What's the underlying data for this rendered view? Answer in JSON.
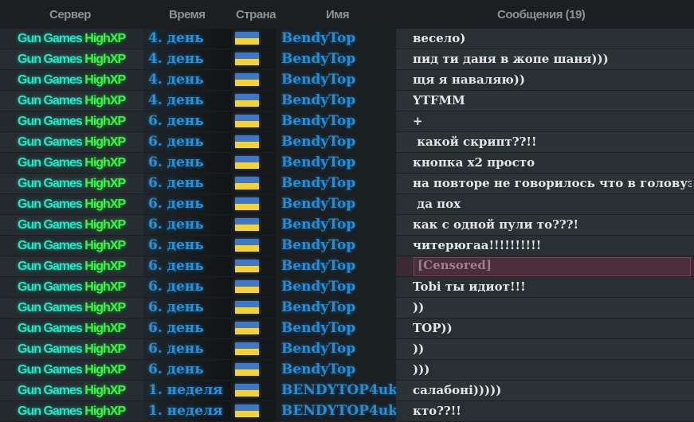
{
  "header": {
    "server": "Сервер",
    "time": "Время",
    "country": "Страна",
    "name": "Имя",
    "messages": "Сообщения (19)"
  },
  "colors": {
    "server_part1": "#24e6c4",
    "server_part2": "#3cf34a",
    "time": "#2e8fd0",
    "name": "#2a8bd0",
    "message": "#e6e6e6",
    "flag_blue": "#3f78c6",
    "flag_yellow": "#f3d23b",
    "censored_bg": "#4a2f3a"
  },
  "rows": [
    {
      "server1": "Gun Games",
      "server2": "HighXP",
      "time": "4. день",
      "flag": "ukraine-flag-icon",
      "name": "BendyTop",
      "message": "весело)"
    },
    {
      "server1": "Gun Games",
      "server2": "HighXP",
      "time": "4. день",
      "flag": "ukraine-flag-icon",
      "name": "BendyTop",
      "message": "пид ти даня в жопе шаня)))"
    },
    {
      "server1": "Gun Games",
      "server2": "HighXP",
      "time": "4. день",
      "flag": "ukraine-flag-icon",
      "name": "BendyTop",
      "message": "щя я наваляю))"
    },
    {
      "server1": "Gun Games",
      "server2": "HighXP",
      "time": "4. день",
      "flag": "ukraine-flag-icon",
      "name": "BendyTop",
      "message": "YTFMM"
    },
    {
      "server1": "Gun Games",
      "server2": "HighXP",
      "time": "6. день",
      "flag": "ukraine-flag-icon",
      "name": "BendyTop",
      "message": "+"
    },
    {
      "server1": "Gun Games",
      "server2": "HighXP",
      "time": "6. день",
      "flag": "ukraine-flag-icon",
      "name": "BendyTop",
      "message": " какой скрипт??!!"
    },
    {
      "server1": "Gun Games",
      "server2": "HighXP",
      "time": "6. день",
      "flag": "ukraine-flag-icon",
      "name": "BendyTop",
      "message": "кнопка x2 просто"
    },
    {
      "server1": "Gun Games",
      "server2": "HighXP",
      "time": "6. день",
      "flag": "ukraine-flag-icon",
      "name": "BendyTop",
      "message": "на повторе не говорилось что в головуэ"
    },
    {
      "server1": "Gun Games",
      "server2": "HighXP",
      "time": "6. день",
      "flag": "ukraine-flag-icon",
      "name": "BendyTop",
      "message": " да пох"
    },
    {
      "server1": "Gun Games",
      "server2": "HighXP",
      "time": "6. день",
      "flag": "ukraine-flag-icon",
      "name": "BendyTop",
      "message": "как с одной пули то???!"
    },
    {
      "server1": "Gun Games",
      "server2": "HighXP",
      "time": "6. день",
      "flag": "ukraine-flag-icon",
      "name": "BendyTop",
      "message": "читерюгаа!!!!!!!!!!"
    },
    {
      "server1": "Gun Games",
      "server2": "HighXP",
      "time": "6. день",
      "flag": "ukraine-flag-icon",
      "name": "BendyTop",
      "message": "[Censored]",
      "censored": true
    },
    {
      "server1": "Gun Games",
      "server2": "HighXP",
      "time": "6. день",
      "flag": "ukraine-flag-icon",
      "name": "BendyTop",
      "message": "Tobi ты идиот!!!"
    },
    {
      "server1": "Gun Games",
      "server2": "HighXP",
      "time": "6. день",
      "flag": "ukraine-flag-icon",
      "name": "BendyTop",
      "message": "))"
    },
    {
      "server1": "Gun Games",
      "server2": "HighXP",
      "time": "6. день",
      "flag": "ukraine-flag-icon",
      "name": "BendyTop",
      "message": "TOP))"
    },
    {
      "server1": "Gun Games",
      "server2": "HighXP",
      "time": "6. день",
      "flag": "ukraine-flag-icon",
      "name": "BendyTop",
      "message": "))"
    },
    {
      "server1": "Gun Games",
      "server2": "HighXP",
      "time": "6. день",
      "flag": "ukraine-flag-icon",
      "name": "BendyTop",
      "message": ")))"
    },
    {
      "server1": "Gun Games",
      "server2": "HighXP",
      "time": "1. неделя",
      "flag": "ukraine-flag-icon",
      "name": "BENDYTOP4uk",
      "message": "салабоні)))))"
    },
    {
      "server1": "Gun Games",
      "server2": "HighXP",
      "time": "1. неделя",
      "flag": "ukraine-flag-icon",
      "name": "BENDYTOP4uk",
      "message": "кто??!!"
    }
  ]
}
